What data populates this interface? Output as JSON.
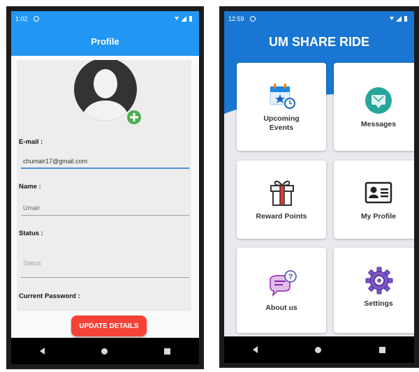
{
  "left_phone": {
    "status": {
      "time": "1:02"
    },
    "app_bar": {
      "title": "Profile"
    },
    "fields": {
      "email_label": "E-mail :",
      "email_value": "chumair17@gmail.com",
      "name_label": "Name :",
      "name_value": "Umair",
      "status_label": "Status :",
      "status_placeholder": "Status",
      "password_label": "Current Password :"
    },
    "update_button": "UPDATE DETAILS",
    "colors": {
      "app_bar": "#2196f3",
      "button": "#f44336"
    }
  },
  "right_phone": {
    "status": {
      "time": "12:59"
    },
    "brand_title": "UM SHARE RIDE",
    "tiles": [
      {
        "label_line1": "Upcoming",
        "label_line2": "Events",
        "icon": "calendar-star-icon"
      },
      {
        "label": "Messages",
        "icon": "message-icon"
      },
      {
        "label": "Reward Points",
        "icon": "gift-icon"
      },
      {
        "label": "My Profile",
        "icon": "id-card-icon"
      },
      {
        "label": "About us",
        "icon": "chat-question-icon"
      },
      {
        "label": "Settings",
        "icon": "gear-icon"
      }
    ],
    "colors": {
      "hero": "#1976d2"
    }
  }
}
